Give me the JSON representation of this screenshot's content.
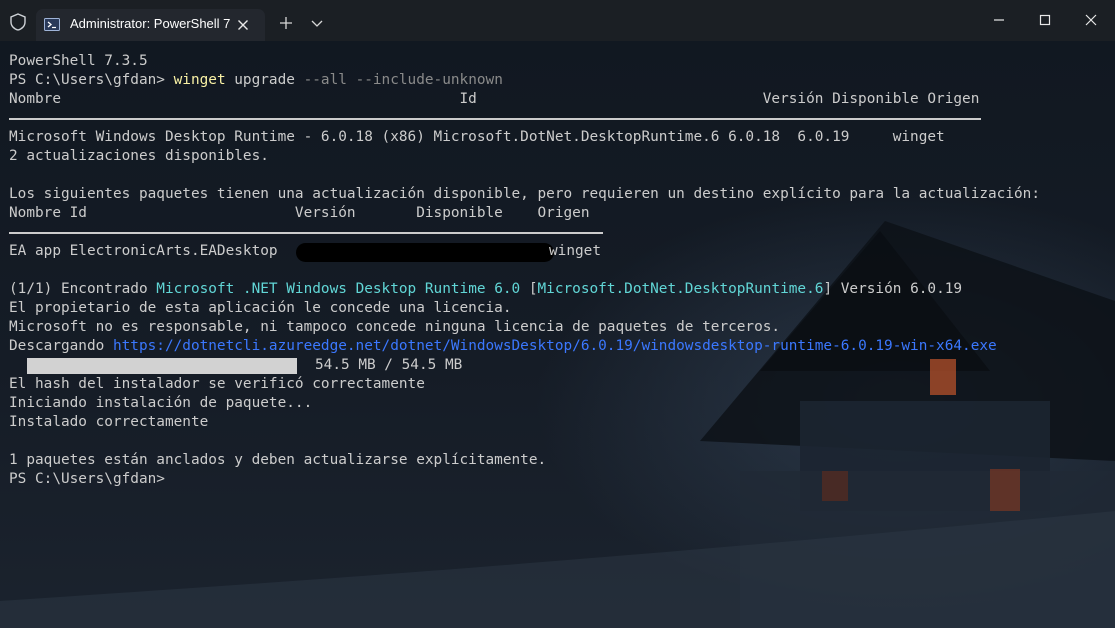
{
  "titlebar": {
    "tab_title": "Administrator: PowerShell 7",
    "icons": [
      "shield-icon",
      "powershell-icon",
      "close-icon",
      "plus-icon",
      "chevron-down-icon",
      "minimize-icon",
      "maximize-icon",
      "close-window-icon"
    ]
  },
  "colors": {
    "text": "#cccccc",
    "command": "#f9f1a5",
    "argument": "#8a8a8a",
    "highlight": "#61d6d6",
    "link": "#3b78ff"
  },
  "terminal": {
    "version": "PowerShell 7.3.5",
    "prompt1": "PS C:\\Users\\gfdan> ",
    "cmd": "winget",
    "cmd_rest": " upgrade",
    "cmd_args": " --all --include-unknown",
    "header1": "Nombre                                              Id                                 Versión Disponible Origen",
    "row1": "Microsoft Windows Desktop Runtime - 6.0.18 (x86) Microsoft.DotNet.DesktopRuntime.6 6.0.18  6.0.19     winget",
    "count": "2 actualizaciones disponibles.",
    "explicit_notice": "Los siguientes paquetes tienen una actualización disponible, pero requieren un destino explícito para la actualización:",
    "header2": "Nombre Id                        Versión       Disponible    Origen",
    "row2_name_id": "EA app ElectronicArts.EADesktop",
    "row2_source": "winget",
    "found_prefix": "(1/1) Encontrado ",
    "found_name": "Microsoft .NET Windows Desktop Runtime 6.0",
    "found_bracket_open": " [",
    "found_id": "Microsoft.DotNet.DesktopRuntime.6",
    "found_bracket_close": "] ",
    "found_version": "Versión 6.0.19",
    "license1": "El propietario de esta aplicación le concede una licencia.",
    "license2": "Microsoft no es responsable, ni tampoco concede ninguna licencia de paquetes de terceros.",
    "download_label": "Descargando ",
    "download_url": "https://dotnetcli.azureedge.net/dotnet/WindowsDesktop/6.0.19/windowsdesktop-runtime-6.0.19-win-x64.exe",
    "download_size": "54.5 MB / 54.5 MB",
    "download_progress_fraction": 1.0,
    "hash_ok": "El hash del instalador se verificó correctamente",
    "installing": "Iniciando instalación de paquete...",
    "installed": "Instalado correctamente",
    "pinned": "1 paquetes están anclados y deben actualizarse explícitamente.",
    "prompt2": "PS C:\\Users\\gfdan>"
  }
}
